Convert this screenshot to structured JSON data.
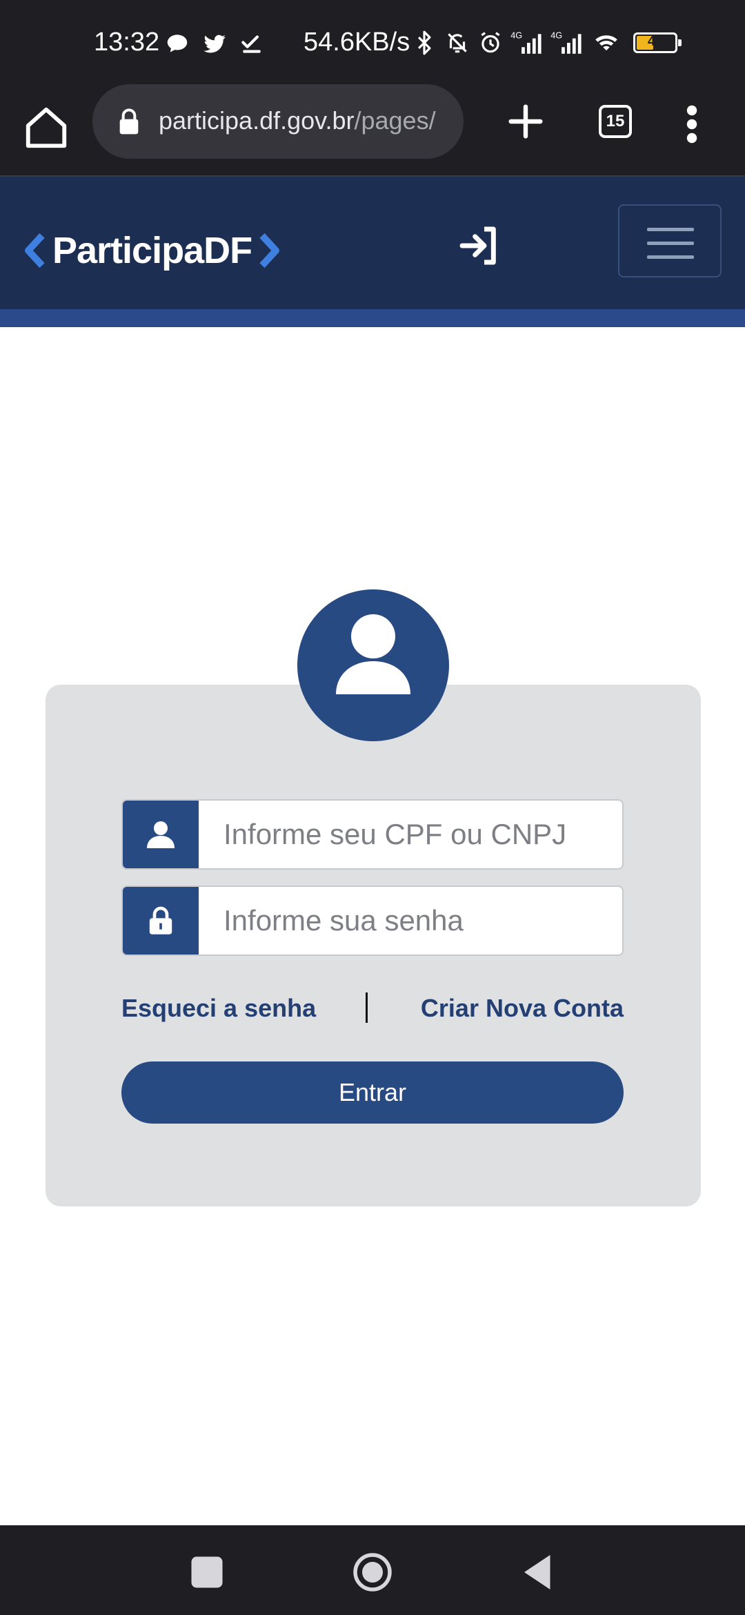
{
  "status_bar": {
    "time": "13:32",
    "network_speed": "54.6KB/s",
    "battery_level": "41",
    "icons": [
      "chat-icon",
      "twitter-icon",
      "download-done-icon",
      "bluetooth-icon",
      "muted-bell-icon",
      "alarm-icon",
      "signal-4g-icon",
      "signal-4g-icon",
      "wifi-icon",
      "battery-icon"
    ]
  },
  "browser": {
    "url_host": "participa.df.gov.br",
    "url_path": "/pages/",
    "tab_count": "15"
  },
  "site": {
    "logo_text": "ParticipaDF",
    "brand_color": "#1c2e52",
    "accent_color": "#284a82"
  },
  "login": {
    "user_placeholder": "Informe seu CPF ou CNPJ",
    "password_placeholder": "Informe sua senha",
    "forgot_password": "Esqueci a senha",
    "create_account": "Criar Nova Conta",
    "submit_label": "Entrar"
  }
}
